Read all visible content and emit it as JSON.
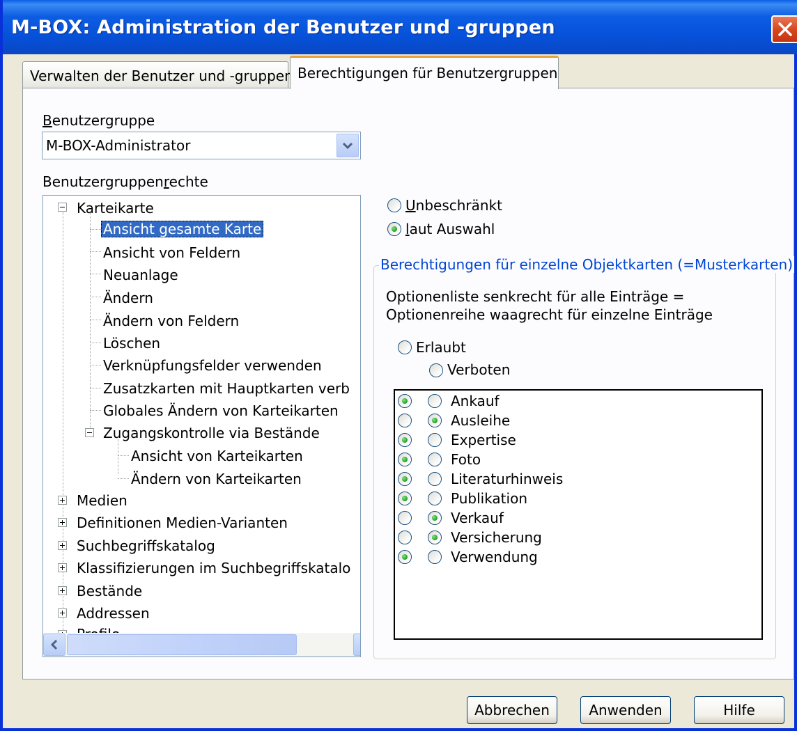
{
  "window": {
    "title": "M-BOX: Administration der Benutzer und -gruppen"
  },
  "tabs": [
    {
      "label": "Verwalten der Benutzer und -gruppen",
      "active": false
    },
    {
      "label": "Berechtigungen für Benutzergruppen",
      "active": true
    }
  ],
  "group_select": {
    "label_prefix": "B",
    "label_rest": "enutzergruppe",
    "value": "M-BOX-Administrator"
  },
  "rights": {
    "label_start": "Benutzergruppen",
    "label_u": "r",
    "label_end": "echte",
    "tree": [
      "Karteikarte",
      "Ansicht gesamte Karte",
      "Ansicht von Feldern",
      "Neuanlage",
      "Ändern",
      "Ändern von Feldern",
      "Löschen",
      "Verknüpfungsfelder verwenden",
      "Zusatzkarten mit Hauptkarten verb",
      "Globales Ändern von Karteikarten",
      "Zugangskontrolle via Bestände",
      "Ansicht von Karteikarten",
      "Ändern von Karteikarten",
      "Medien",
      "Definitionen Medien-Varianten",
      "Suchbegriffskatalog",
      "Klassifizierungen im Suchbegriffskatalo",
      "Bestände",
      "Addressen",
      "Profile"
    ],
    "selected": "Ansicht gesamte Karte"
  },
  "scope": {
    "unlimited_u": "U",
    "unlimited_rest": "nbeschränkt",
    "by_selection_u": "l",
    "by_selection_rest": "aut Auswahl",
    "selected": "laut Auswahl"
  },
  "objektkarten": {
    "legend": "Berechtigungen für einzelne Objektkarten (=Musterkarten)",
    "hint_line1": "Optionenliste senkrecht für alle Einträge =",
    "hint_line2": "Optionenreihe waagrecht für einzelne Einträge",
    "allowed_label": "Erlaubt",
    "forbidden_label": "Verboten",
    "items": [
      {
        "name": "Ankauf",
        "state": "Erlaubt"
      },
      {
        "name": "Ausleihe",
        "state": "Verboten"
      },
      {
        "name": "Expertise",
        "state": "Erlaubt"
      },
      {
        "name": "Foto",
        "state": "Erlaubt"
      },
      {
        "name": "Literaturhinweis",
        "state": "Erlaubt"
      },
      {
        "name": "Publikation",
        "state": "Erlaubt"
      },
      {
        "name": "Verkauf",
        "state": "Verboten"
      },
      {
        "name": "Versicherung",
        "state": "Verboten"
      },
      {
        "name": "Verwendung",
        "state": "Erlaubt"
      }
    ]
  },
  "buttons": {
    "cancel": "Abbrechen",
    "apply": "Anwenden",
    "help": "Hilfe"
  },
  "colors": {
    "title_bar": "#0650d8",
    "selection": "#316ac5",
    "group_legend": "#0046d5",
    "radio_on": "#21a121"
  }
}
